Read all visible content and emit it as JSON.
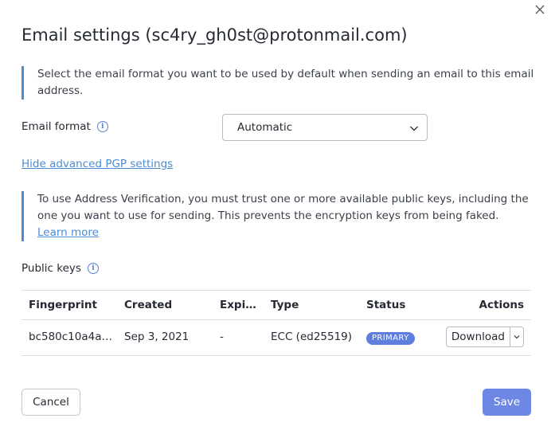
{
  "dialog": {
    "title": "Email settings (sc4ry_gh0st@protonmail.com)",
    "format_info": "Select the email format you want to be used by default when sending an email to this email address.",
    "email_format_label": "Email format",
    "email_format_value": "Automatic",
    "advanced_link": "Hide advanced PGP settings",
    "verification_info": "To use Address Verification, you must trust one or more available public keys, including the one you want to use for sending. This prevents the encryption keys from being faked.",
    "learn_more": "Learn more",
    "public_keys_label": "Public keys"
  },
  "table": {
    "headers": {
      "fingerprint": "Fingerprint",
      "created": "Created",
      "expires": "Expir…",
      "type": "Type",
      "status": "Status",
      "actions": "Actions"
    },
    "rows": [
      {
        "fingerprint": "bc580c10a4ac…",
        "created": "Sep 3, 2021",
        "expires": "-",
        "type": "ECC (ed25519)",
        "status": "PRIMARY",
        "action": "Download"
      }
    ]
  },
  "footer": {
    "cancel": "Cancel",
    "save": "Save"
  },
  "colors": {
    "accent": "#6d88e4",
    "link": "#4b8bd6",
    "badge": "#5f7fdf"
  },
  "icons": [
    "close-icon",
    "info-icon",
    "chevron-down-icon"
  ]
}
